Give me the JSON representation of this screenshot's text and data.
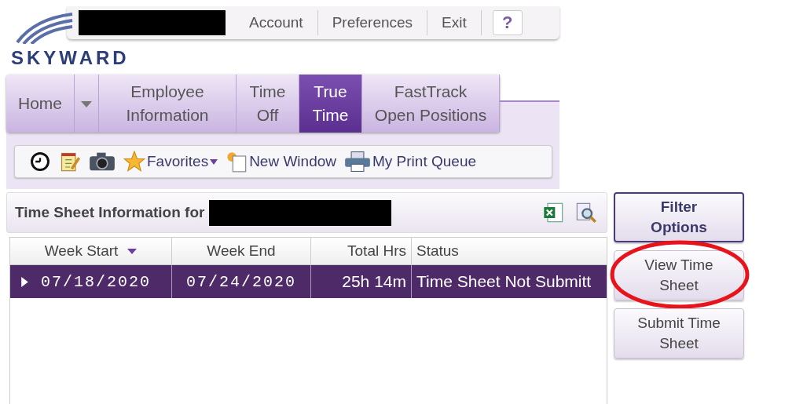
{
  "top_links": [
    "Account",
    "Preferences",
    "Exit"
  ],
  "help_button": "?",
  "logo": "SKYWARD",
  "nav_tabs": [
    {
      "label": "Home",
      "selected": false,
      "kind": "tab"
    },
    {
      "selected": false,
      "kind": "dropdown"
    },
    {
      "label": "Employee Information",
      "selected": false,
      "kind": "tab"
    },
    {
      "label": "Time Off",
      "selected": false,
      "kind": "tab"
    },
    {
      "label": "True Time",
      "selected": true,
      "kind": "tab"
    },
    {
      "label": "FastTrack Open Positions",
      "selected": false,
      "kind": "tab"
    }
  ],
  "toolbar": [
    {
      "kind": "clock"
    },
    {
      "kind": "notepad"
    },
    {
      "kind": "camera"
    },
    {
      "kind": "star",
      "label": "Favorites"
    },
    {
      "kind": "window",
      "label": "New Window"
    },
    {
      "kind": "printer",
      "label": "My Print Queue"
    }
  ],
  "panel": {
    "title": "Time Sheet Information for"
  },
  "table": {
    "columns": [
      "Week Start",
      "Week End",
      "Total Hrs",
      "Status"
    ],
    "rows": [
      {
        "cells": [
          "07/18/2020",
          "07/24/2020",
          "25h 14m",
          "Time Sheet Not Submitt"
        ],
        "selected": true
      }
    ]
  },
  "side_buttons": [
    {
      "label": "Filter Options",
      "kind": "primary",
      "highlighted": false
    },
    {
      "label": "View Time Sheet",
      "kind": "normal",
      "highlighted": true
    },
    {
      "label": "Submit Time Sheet",
      "kind": "normal",
      "highlighted": false
    }
  ]
}
